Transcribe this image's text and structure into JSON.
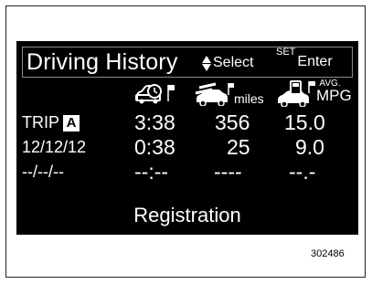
{
  "header": {
    "title": "Driving History",
    "select_label": "Select",
    "set_label": "SET",
    "enter_label": "Enter"
  },
  "columns": {
    "miles_unit": "miles",
    "avg_unit": "AVG.",
    "mpg_unit": "MPG"
  },
  "rows": [
    {
      "label": "TRIP",
      "badge": "A",
      "time": "3:38",
      "distance": "356",
      "mpg": "15.0"
    },
    {
      "label": "12/12/12",
      "time": "0:38",
      "distance": "25",
      "mpg": "9.0"
    },
    {
      "label": "--/--/--",
      "time": "--:--",
      "distance": "----",
      "mpg": "--.-"
    }
  ],
  "registration_label": "Registration",
  "figure_code": "302486",
  "icons": [
    "car-clock-icon",
    "car-flag-miles-icon",
    "car-fuel-flag-icon",
    "up-down-arrows-icon"
  ],
  "colors": {
    "screen": "#000000",
    "text": "#ffffff",
    "header_border": "#8a8a8a"
  }
}
